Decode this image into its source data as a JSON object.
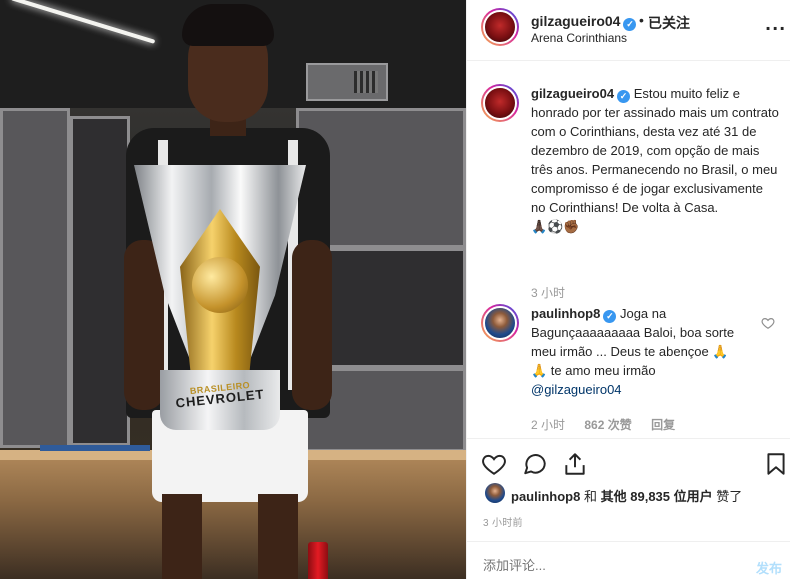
{
  "header": {
    "username": "gilzagueiro04",
    "verified_mark": "✓",
    "dot": "•",
    "follow_status": "已关注",
    "location": "Arena Corinthians",
    "more_label": "..."
  },
  "caption": {
    "username": "gilzagueiro04",
    "text": "Estou muito feliz e honrado por ter assinado mais um contrato com o Corinthians, desta vez até 31 de dezembro de 2019, com opção de mais três anos. Permanecendo no Brasil, o meu compromisso é de jogar exclusivamente no Corinthians! De volta à Casa.",
    "emojis": "🙏🏿⚽✊🏾",
    "time": "3 小时"
  },
  "comment": {
    "username": "paulinhop8",
    "text": "Joga na Bagunçaaaaaaaaa Baloi, boa sorte meu irmão ... Deus te abençoe 🙏 🙏 te amo meu irmão",
    "mention": "@gilzagueiro04",
    "time": "2 小时",
    "likes": "862 次赞",
    "reply": "回复"
  },
  "photo": {
    "trophy_label_top": "BRASILEIRO",
    "trophy_label": "CHEVROLET"
  },
  "likes": {
    "user": "paulinhop8",
    "and": "和",
    "others_prefix": "其他",
    "count": "89,835",
    "suffix": "位用户",
    "liked": "赞了"
  },
  "post_time": "3 小时前",
  "add_comment": {
    "placeholder": "添加评论...",
    "post_label": "发布"
  },
  "icons": [
    "heart-icon",
    "comment-icon",
    "share-icon",
    "bookmark-icon",
    "more-icon",
    "verified-icon"
  ],
  "colors": {
    "verified": "#3897f0",
    "post_disabled": "#b2dffc",
    "meta": "#999999"
  }
}
